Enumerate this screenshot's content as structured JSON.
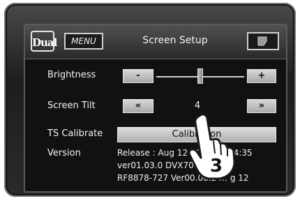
{
  "header": {
    "logo_text": "Dual",
    "menu_label": "MENU",
    "title": "Screen Setup",
    "back_icon": "back-arrow-icon"
  },
  "settings": {
    "brightness": {
      "label": "Brightness",
      "decrease_label": "-",
      "increase_label": "+",
      "level": 0.5
    },
    "screen_tilt": {
      "label": "Screen Tilt",
      "prev_label": "«",
      "next_label": "»",
      "value": "4"
    },
    "ts_calibrate": {
      "label": "TS Calibrate",
      "button_label": "Calibration"
    },
    "version": {
      "label": "Version",
      "lines": [
        "Release : Aug 12 20 … 16:44:35",
        "ver01.03.0 DVX700",
        "RF8878-727 Ver00.06.2 … g 12"
      ]
    }
  },
  "overlay": {
    "step_number": "3",
    "icon": "pointing-hand-icon"
  },
  "colors": {
    "screen_bg": "#111111",
    "button_face": "#c8c8c8",
    "text": "#f4f4f4"
  }
}
